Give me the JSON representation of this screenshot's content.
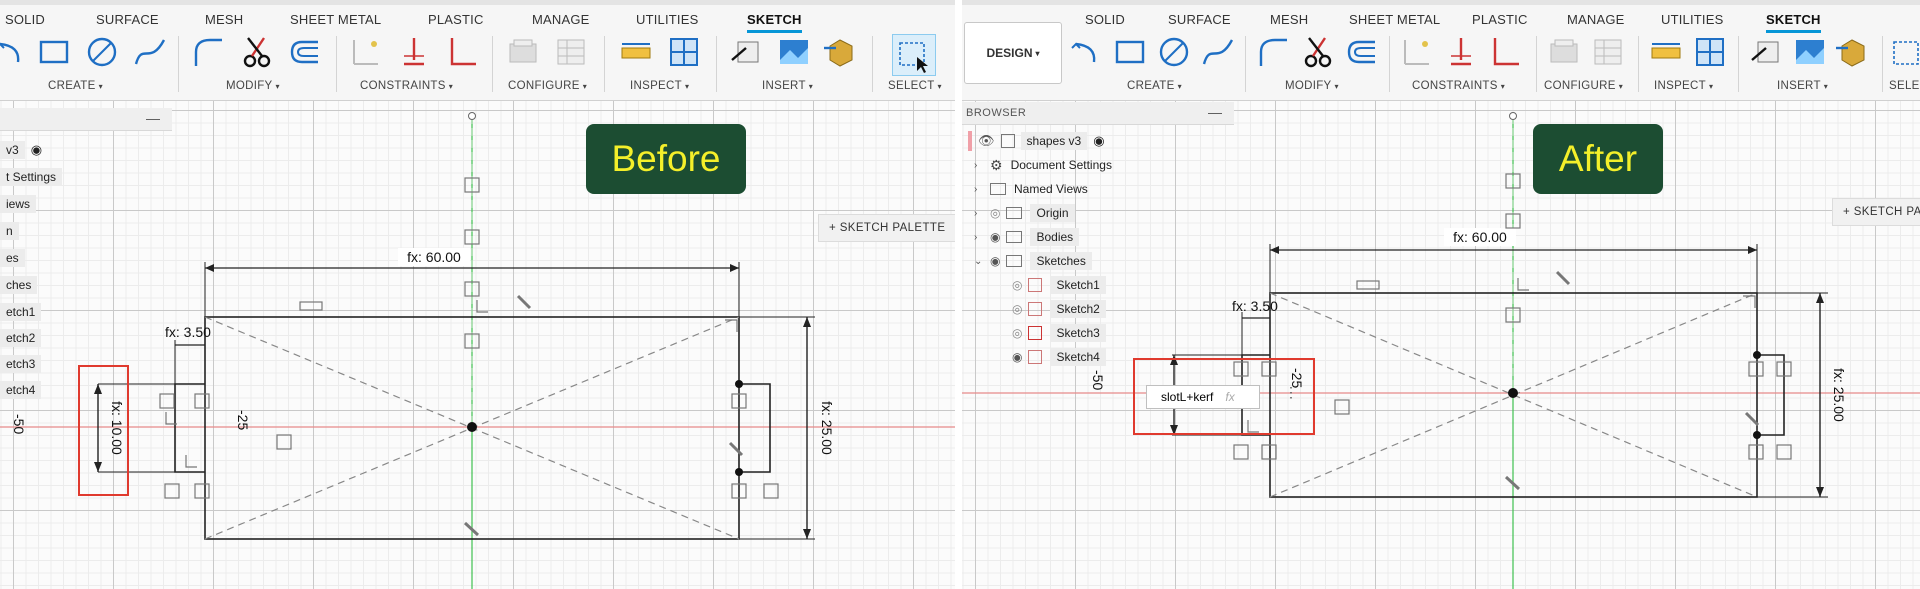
{
  "tabs": [
    "SOLID",
    "SURFACE",
    "MESH",
    "SHEET METAL",
    "PLASTIC",
    "MANAGE",
    "UTILITIES",
    "SKETCH"
  ],
  "groups": {
    "create": "CREATE",
    "modify": "MODIFY",
    "constraints": "CONSTRAINTS",
    "configure": "CONFIGURE",
    "inspect": "INSPECT",
    "insert": "INSERT",
    "select": "SELECT",
    "select_trunc": "SELE"
  },
  "caret": "▾",
  "design_button": "DESIGN",
  "before": {
    "label": "Before",
    "browser": {
      "rows": [
        "v3",
        "t Settings",
        "iews",
        "n",
        "es",
        "ches",
        "etch1",
        "etch2",
        "etch3",
        "etch4"
      ]
    },
    "palette": "+ SKETCH PALETTE",
    "dims": {
      "width": "fx: 60.00",
      "offset": "fx: 3.50",
      "slot": "fx: 10.00",
      "height": "fx: 25.00",
      "neg25": "-25",
      "neg50": "-50"
    }
  },
  "after": {
    "label": "After",
    "browser": {
      "title": "BROWSER",
      "root": "shapes v3",
      "items": [
        "Document Settings",
        "Named Views",
        "Origin",
        "Bodies",
        "Sketches",
        "Sketch1",
        "Sketch2",
        "Sketch3",
        "Sketch4"
      ]
    },
    "palette": "+ SKETCH PA",
    "dims": {
      "width": "fx: 60.00",
      "offset": "fx: 3.50",
      "height": "fx: 25.00",
      "neg25": "-25",
      "neg50": "-50"
    },
    "expression_input": {
      "value": "slotL+kerf",
      "fx": "fx"
    }
  },
  "colors": {
    "accent": "#0696d7",
    "badge_bg": "#1c4d32",
    "badge_text": "#f4ef2a",
    "highlight": "#e03a2e"
  }
}
